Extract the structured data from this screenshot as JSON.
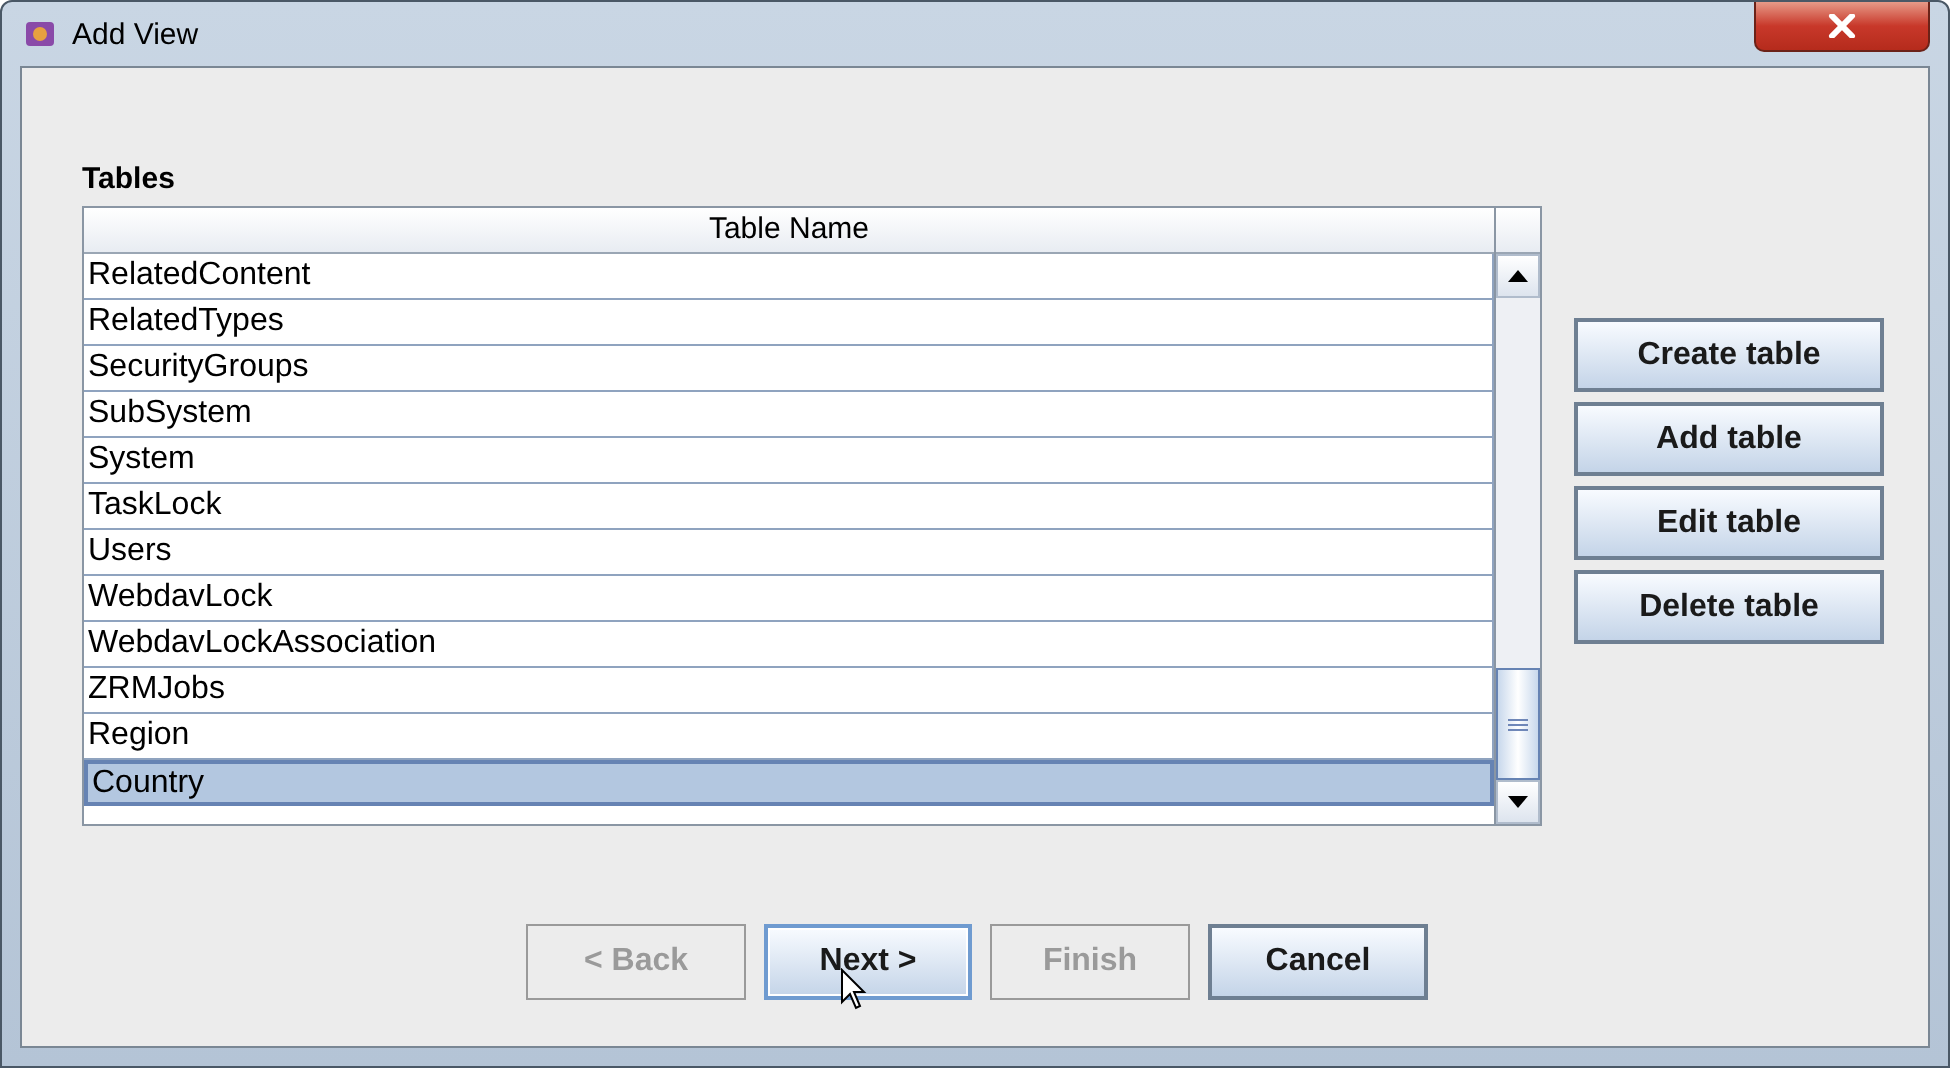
{
  "window": {
    "title": "Add View"
  },
  "section_label": "Tables",
  "table": {
    "columns": [
      "Table Name"
    ],
    "rows": [
      {
        "name": "RelatedContent",
        "selected": false
      },
      {
        "name": "RelatedTypes",
        "selected": false
      },
      {
        "name": "SecurityGroups",
        "selected": false
      },
      {
        "name": "SubSystem",
        "selected": false
      },
      {
        "name": "System",
        "selected": false
      },
      {
        "name": "TaskLock",
        "selected": false
      },
      {
        "name": "Users",
        "selected": false
      },
      {
        "name": "WebdavLock",
        "selected": false
      },
      {
        "name": "WebdavLockAssociation",
        "selected": false
      },
      {
        "name": "ZRMJobs",
        "selected": false
      },
      {
        "name": "Region",
        "selected": false
      },
      {
        "name": "Country",
        "selected": true
      }
    ]
  },
  "side_buttons": [
    "Create table",
    "Add table",
    "Edit table",
    "Delete table"
  ],
  "wizard_buttons": [
    {
      "label": "< Back",
      "disabled": true,
      "focused": false
    },
    {
      "label": "Next >",
      "disabled": false,
      "focused": true
    },
    {
      "label": "Finish",
      "disabled": true,
      "focused": false
    },
    {
      "label": "Cancel",
      "disabled": false,
      "focused": false
    }
  ]
}
